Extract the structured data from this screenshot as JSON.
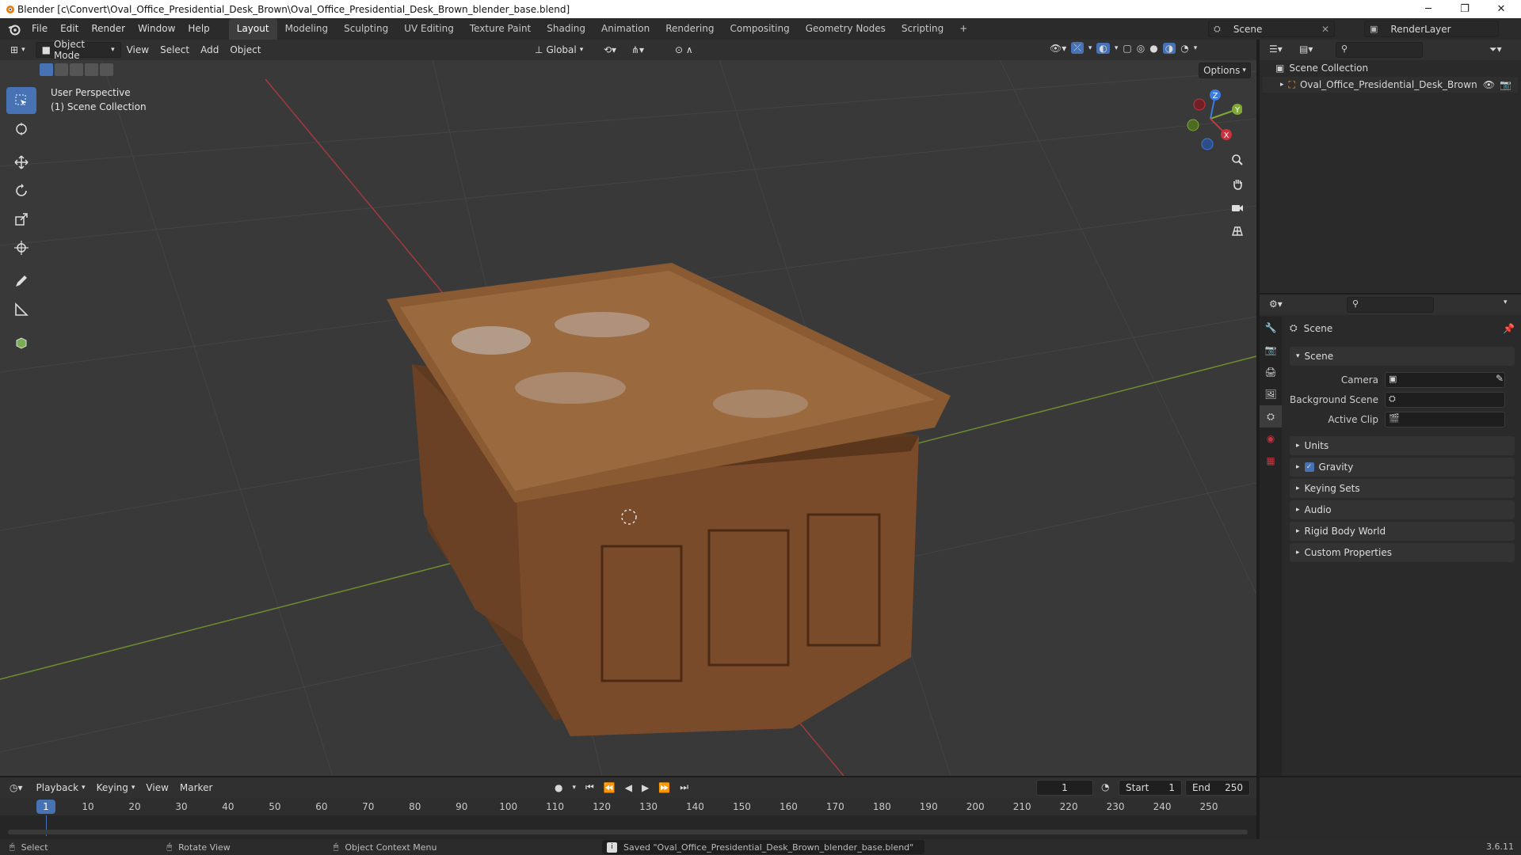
{
  "window": {
    "title": "Blender [c\\Convert\\Oval_Office_Presidential_Desk_Brown\\Oval_Office_Presidential_Desk_Brown_blender_base.blend]",
    "minimize": "─",
    "maximize": "❐",
    "close": "✕"
  },
  "menu": {
    "items": [
      "File",
      "Edit",
      "Render",
      "Window",
      "Help"
    ],
    "workspaces": [
      "Layout",
      "Modeling",
      "Sculpting",
      "UV Editing",
      "Texture Paint",
      "Shading",
      "Animation",
      "Rendering",
      "Compositing",
      "Geometry Nodes",
      "Scripting"
    ],
    "active_workspace": "Layout",
    "add_workspace": "+",
    "scene_name": "Scene",
    "render_layer": "RenderLayer"
  },
  "viewport": {
    "mode": "Object Mode",
    "menus": [
      "View",
      "Select",
      "Add",
      "Object"
    ],
    "orientation": "Global",
    "options_label": "Options",
    "overlay_line1": "User Perspective",
    "overlay_line2": "(1) Scene Collection",
    "gizmo": {
      "x": "X",
      "y": "Y",
      "z": "Z"
    }
  },
  "outliner": {
    "root": "Scene Collection",
    "object": "Oval_Office_Presidential_Desk_Brown"
  },
  "properties": {
    "context_title": "Scene",
    "panel_title": "Scene",
    "camera_label": "Camera",
    "background_scene_label": "Background Scene",
    "active_clip_label": "Active Clip",
    "sections": [
      "Units",
      "Gravity",
      "Keying Sets",
      "Audio",
      "Rigid Body World",
      "Custom Properties"
    ],
    "gravity_checked": true
  },
  "timeline": {
    "menus": [
      "Playback",
      "Keying",
      "View",
      "Marker"
    ],
    "current_frame": "1",
    "start_label": "Start",
    "start_value": "1",
    "end_label": "End",
    "end_value": "250",
    "ticks": [
      "1",
      "10",
      "20",
      "30",
      "40",
      "50",
      "60",
      "70",
      "80",
      "90",
      "100",
      "110",
      "120",
      "130",
      "140",
      "150",
      "160",
      "170",
      "180",
      "190",
      "200",
      "210",
      "220",
      "230",
      "240",
      "250"
    ]
  },
  "statusbar": {
    "select": "Select",
    "rotate": "Rotate View",
    "context_menu": "Object Context Menu",
    "message": "Saved \"Oval_Office_Presidential_Desk_Brown_blender_base.blend\"",
    "version": "3.6.11"
  },
  "colors": {
    "accent": "#4772b3",
    "x_axis": "#c8333f",
    "y_axis": "#7fa834",
    "z_axis": "#3d7be0"
  }
}
